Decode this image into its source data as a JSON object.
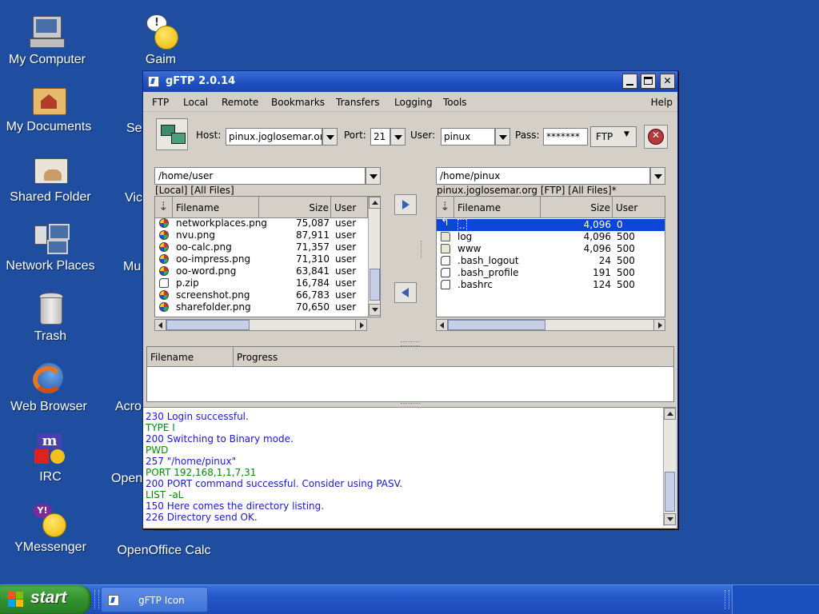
{
  "desktop": {
    "icons": [
      {
        "label": "My Computer",
        "icon": "computer-icon"
      },
      {
        "label": "My Documents",
        "icon": "documents-folder-icon"
      },
      {
        "label": "Shared Folder",
        "icon": "shared-folder-icon"
      },
      {
        "label": "Network Places",
        "icon": "network-icon"
      },
      {
        "label": "Trash",
        "icon": "trash-icon"
      },
      {
        "label": "Web Browser",
        "icon": "firefox-icon"
      },
      {
        "label": "IRC",
        "icon": "irc-icon"
      },
      {
        "label": "YMessenger",
        "icon": "yahoo-messenger-icon"
      },
      {
        "label": "Gaim",
        "icon": "gaim-icon"
      },
      {
        "label": "OpenOffice Calc",
        "icon": "calc-icon"
      }
    ],
    "partial_labels": [
      "Se",
      "Vic",
      "Mu",
      "Acro",
      "Open"
    ]
  },
  "window": {
    "title": "gFTP 2.0.14",
    "menu": [
      "FTP",
      "Local",
      "Remote",
      "Bookmarks",
      "Transfers",
      "Logging",
      "Tools",
      "Help"
    ],
    "toolbar": {
      "host_label": "Host:",
      "host_value": "pinux.joglosemar.org",
      "port_label": "Port:",
      "port_value": "21",
      "user_label": "User:",
      "user_value": "pinux",
      "pass_label": "Pass:",
      "pass_value": "*******",
      "protocol": "FTP"
    },
    "local": {
      "path": "/home/user",
      "info": "[Local] [All Files]",
      "columns": [
        "Filename",
        "Size",
        "User"
      ],
      "files": [
        {
          "name": "networkplaces.png",
          "size": "75,087",
          "user": "user",
          "type": "image"
        },
        {
          "name": "nvu.png",
          "size": "87,911",
          "user": "user",
          "type": "image"
        },
        {
          "name": "oo-calc.png",
          "size": "71,357",
          "user": "user",
          "type": "image"
        },
        {
          "name": "oo-impress.png",
          "size": "71,310",
          "user": "user",
          "type": "image"
        },
        {
          "name": "oo-word.png",
          "size": "63,841",
          "user": "user",
          "type": "image"
        },
        {
          "name": "p.zip",
          "size": "16,784",
          "user": "user",
          "type": "file"
        },
        {
          "name": "screenshot.png",
          "size": "66,783",
          "user": "user",
          "type": "image"
        },
        {
          "name": "sharefolder.png",
          "size": "70,650",
          "user": "user",
          "type": "image"
        }
      ]
    },
    "remote": {
      "path": "/home/pinux",
      "info": "pinux.joglosemar.org [FTP] [All Files]*",
      "columns": [
        "Filename",
        "Size",
        "User"
      ],
      "files": [
        {
          "name": "..",
          "size": "4,096",
          "user": "0",
          "type": "up",
          "selected": true
        },
        {
          "name": "log",
          "size": "4,096",
          "user": "500",
          "type": "folder"
        },
        {
          "name": "www",
          "size": "4,096",
          "user": "500",
          "type": "folder"
        },
        {
          "name": ".bash_logout",
          "size": "24",
          "user": "500",
          "type": "file"
        },
        {
          "name": ".bash_profile",
          "size": "191",
          "user": "500",
          "type": "file"
        },
        {
          "name": ".bashrc",
          "size": "124",
          "user": "500",
          "type": "file"
        }
      ]
    },
    "transfers": {
      "columns": [
        "Filename",
        "Progress"
      ]
    },
    "log": [
      {
        "text": "230 Login successful.",
        "kind": "srv"
      },
      {
        "text": "TYPE I",
        "kind": "cmd"
      },
      {
        "text": "200 Switching to Binary mode.",
        "kind": "srv"
      },
      {
        "text": "PWD",
        "kind": "cmd"
      },
      {
        "text": "257 \"/home/pinux\"",
        "kind": "srv"
      },
      {
        "text": "PORT 192,168,1,1,7,31",
        "kind": "cmd"
      },
      {
        "text": "200 PORT command successful. Consider using PASV.",
        "kind": "srv"
      },
      {
        "text": "LIST -aL",
        "kind": "cmd"
      },
      {
        "text": "150 Here comes the directory listing.",
        "kind": "srv"
      },
      {
        "text": "226 Directory send OK.",
        "kind": "srv"
      }
    ]
  },
  "taskbar": {
    "start_label": "start",
    "items": [
      {
        "label": "gFTP Icon"
      }
    ]
  }
}
